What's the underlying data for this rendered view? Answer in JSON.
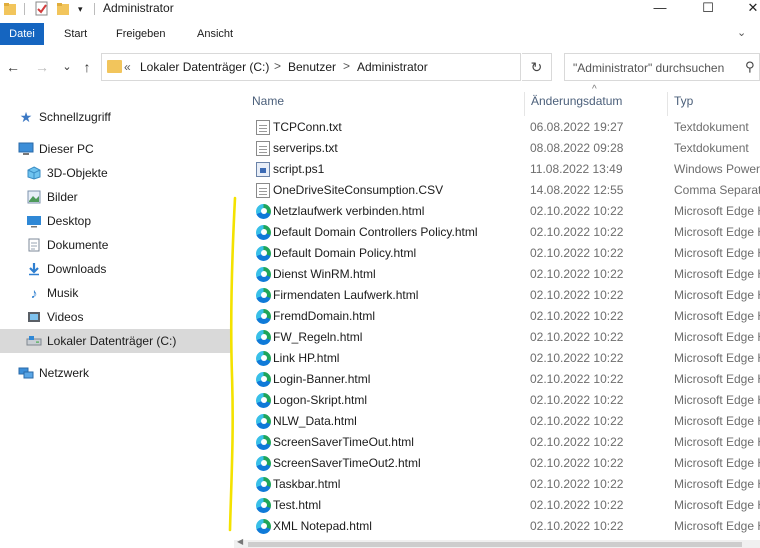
{
  "window": {
    "title": "Administrator",
    "controls": {
      "minimize": "—",
      "maximize": "☐",
      "close": "✕"
    }
  },
  "ribbon": {
    "tabs": [
      "Datei",
      "Start",
      "Freigeben",
      "Ansicht"
    ],
    "expand_icon": "chevron-down-icon",
    "accent_color": "#1565c0"
  },
  "address": {
    "back": "←",
    "forward": "→",
    "recent": "⌄",
    "up": "↑",
    "overflow": "«",
    "crumbs": [
      "Lokaler Datenträger (C:)",
      "Benutzer",
      "Administrator"
    ],
    "separator": ">",
    "refresh": "↻"
  },
  "search": {
    "placeholder": "\"Administrator\" durchsuchen",
    "icon": "⚲"
  },
  "sidebar": {
    "items": [
      {
        "label": "Schnellzugriff",
        "icon": "star-icon"
      },
      {
        "label": "Dieser PC",
        "icon": "computer-icon"
      },
      {
        "label": "3D-Objekte",
        "icon": "cube-icon"
      },
      {
        "label": "Bilder",
        "icon": "pictures-icon"
      },
      {
        "label": "Desktop",
        "icon": "desktop-icon"
      },
      {
        "label": "Dokumente",
        "icon": "documents-icon"
      },
      {
        "label": "Downloads",
        "icon": "download-icon"
      },
      {
        "label": "Musik",
        "icon": "music-icon"
      },
      {
        "label": "Videos",
        "icon": "video-icon"
      },
      {
        "label": "Lokaler Datenträger (C:)",
        "icon": "drive-icon"
      },
      {
        "label": "Netzwerk",
        "icon": "network-icon"
      }
    ],
    "selected": "Lokaler Datenträger (C:)"
  },
  "list": {
    "columns": [
      "Name",
      "Änderungsdatum",
      "Typ"
    ],
    "sort_indicator": "^",
    "rows": [
      {
        "name": "TCPConn.txt",
        "date": "06.08.2022 19:27",
        "type": "Textdokument",
        "icon": "text-file-icon"
      },
      {
        "name": "serverips.txt",
        "date": "08.08.2022 09:28",
        "type": "Textdokument",
        "icon": "text-file-icon"
      },
      {
        "name": "script.ps1",
        "date": "11.08.2022 13:49",
        "type": "Windows PowerShell",
        "icon": "powershell-file-icon"
      },
      {
        "name": "OneDriveSiteConsumption.CSV",
        "date": "14.08.2022 12:55",
        "type": "Comma Separated",
        "icon": "csv-file-icon"
      },
      {
        "name": "Netzlaufwerk verbinden.html",
        "date": "02.10.2022 10:22",
        "type": "Microsoft Edge HTML",
        "icon": "edge-icon"
      },
      {
        "name": "Default Domain Controllers Policy.html",
        "date": "02.10.2022 10:22",
        "type": "Microsoft Edge HTML",
        "icon": "edge-icon"
      },
      {
        "name": "Default Domain Policy.html",
        "date": "02.10.2022 10:22",
        "type": "Microsoft Edge HTML",
        "icon": "edge-icon"
      },
      {
        "name": "Dienst WinRM.html",
        "date": "02.10.2022 10:22",
        "type": "Microsoft Edge HTML",
        "icon": "edge-icon"
      },
      {
        "name": "Firmendaten Laufwerk.html",
        "date": "02.10.2022 10:22",
        "type": "Microsoft Edge HTML",
        "icon": "edge-icon"
      },
      {
        "name": "FremdDomain.html",
        "date": "02.10.2022 10:22",
        "type": "Microsoft Edge HTML",
        "icon": "edge-icon"
      },
      {
        "name": "FW_Regeln.html",
        "date": "02.10.2022 10:22",
        "type": "Microsoft Edge HTML",
        "icon": "edge-icon"
      },
      {
        "name": "Link HP.html",
        "date": "02.10.2022 10:22",
        "type": "Microsoft Edge HTML",
        "icon": "edge-icon"
      },
      {
        "name": "Login-Banner.html",
        "date": "02.10.2022 10:22",
        "type": "Microsoft Edge HTML",
        "icon": "edge-icon"
      },
      {
        "name": "Logon-Skript.html",
        "date": "02.10.2022 10:22",
        "type": "Microsoft Edge HTML",
        "icon": "edge-icon"
      },
      {
        "name": "NLW_Data.html",
        "date": "02.10.2022 10:22",
        "type": "Microsoft Edge HTML",
        "icon": "edge-icon"
      },
      {
        "name": "ScreenSaverTimeOut.html",
        "date": "02.10.2022 10:22",
        "type": "Microsoft Edge HTML",
        "icon": "edge-icon"
      },
      {
        "name": "ScreenSaverTimeOut2.html",
        "date": "02.10.2022 10:22",
        "type": "Microsoft Edge HTML",
        "icon": "edge-icon"
      },
      {
        "name": "Taskbar.html",
        "date": "02.10.2022 10:22",
        "type": "Microsoft Edge HTML",
        "icon": "edge-icon"
      },
      {
        "name": "Test.html",
        "date": "02.10.2022 10:22",
        "type": "Microsoft Edge HTML",
        "icon": "edge-icon"
      },
      {
        "name": "XML Notepad.html",
        "date": "02.10.2022 10:22",
        "type": "Microsoft Edge HTML",
        "icon": "edge-icon"
      }
    ]
  },
  "annotation": {
    "color": "#f4e200"
  }
}
